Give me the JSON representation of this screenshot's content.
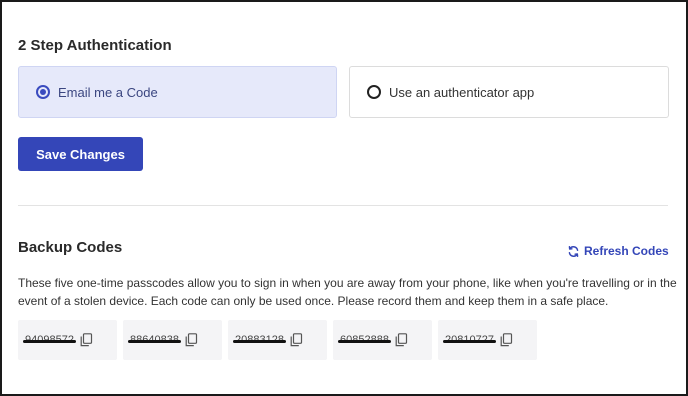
{
  "two_step": {
    "title": "2 Step Authentication",
    "options": [
      {
        "label": "Email me a Code",
        "selected": true
      },
      {
        "label": "Use an authenticator app",
        "selected": false
      }
    ],
    "save_label": "Save Changes"
  },
  "backup": {
    "title": "Backup Codes",
    "refresh_label": "Refresh Codes",
    "description": "These five one-time passcodes allow you to sign in when you are away from your phone, like when you're travelling or in the event of a stolen device. Each code can only be used once. Please record them and keep them in a safe place.",
    "codes": [
      "94098572",
      "88640838",
      "20883128",
      "60852888",
      "20810727"
    ]
  },
  "colors": {
    "accent": "#3446b8",
    "selected_bg": "#e6e9fa"
  },
  "icons": {
    "refresh": "refresh-icon",
    "copy": "copy-icon"
  }
}
